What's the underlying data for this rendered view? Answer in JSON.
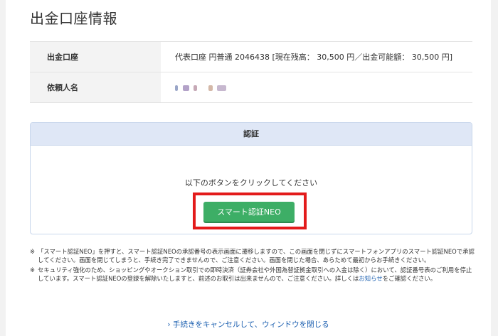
{
  "page_title": "出金口座情報",
  "account": {
    "label": "出金口座",
    "value": "代表口座 円普通 2046438 [現在残高： 30,500 円／出金可能額： 30,500 円]"
  },
  "requester": {
    "label": "依頼人名"
  },
  "auth": {
    "header": "認証",
    "message": "以下のボタンをクリックしてください",
    "button_label": "スマート認証NEO"
  },
  "notes": [
    {
      "mark": "※",
      "text": "「スマート認証NEO」を押すと、スマート認証NEOの承認番号の表示画面に遷移しますので、この画面を閉じずにスマートフォンアプリのスマート認証NEOで承認してください。画面を閉じてしまうと、手続き完了できませんので、ご注意ください。画面を閉じた場合、あらためて最初からお手続きください。"
    },
    {
      "mark": "※",
      "text_before": "セキュリティ強化のため、ショッピングやオークション取引での即時決済（証券会社や外国為替証拠金取引への入金は除く）において、認証番号表のご利用を停止しています。スマート認証NEOの登録を解除いたしますと、前述のお取引は出来ませんので、ご注意ください。詳しくは",
      "link": "お知らせ",
      "text_after": "をご確認ください。"
    }
  ],
  "cancel_link": "› 手続きをキャンセルして、ウィンドウを閉じる",
  "colors": {
    "button": "#3dae66",
    "highlight_frame": "#e31b1b",
    "link": "#1b5fb0",
    "auth_header_bg": "#dfe7f6"
  }
}
